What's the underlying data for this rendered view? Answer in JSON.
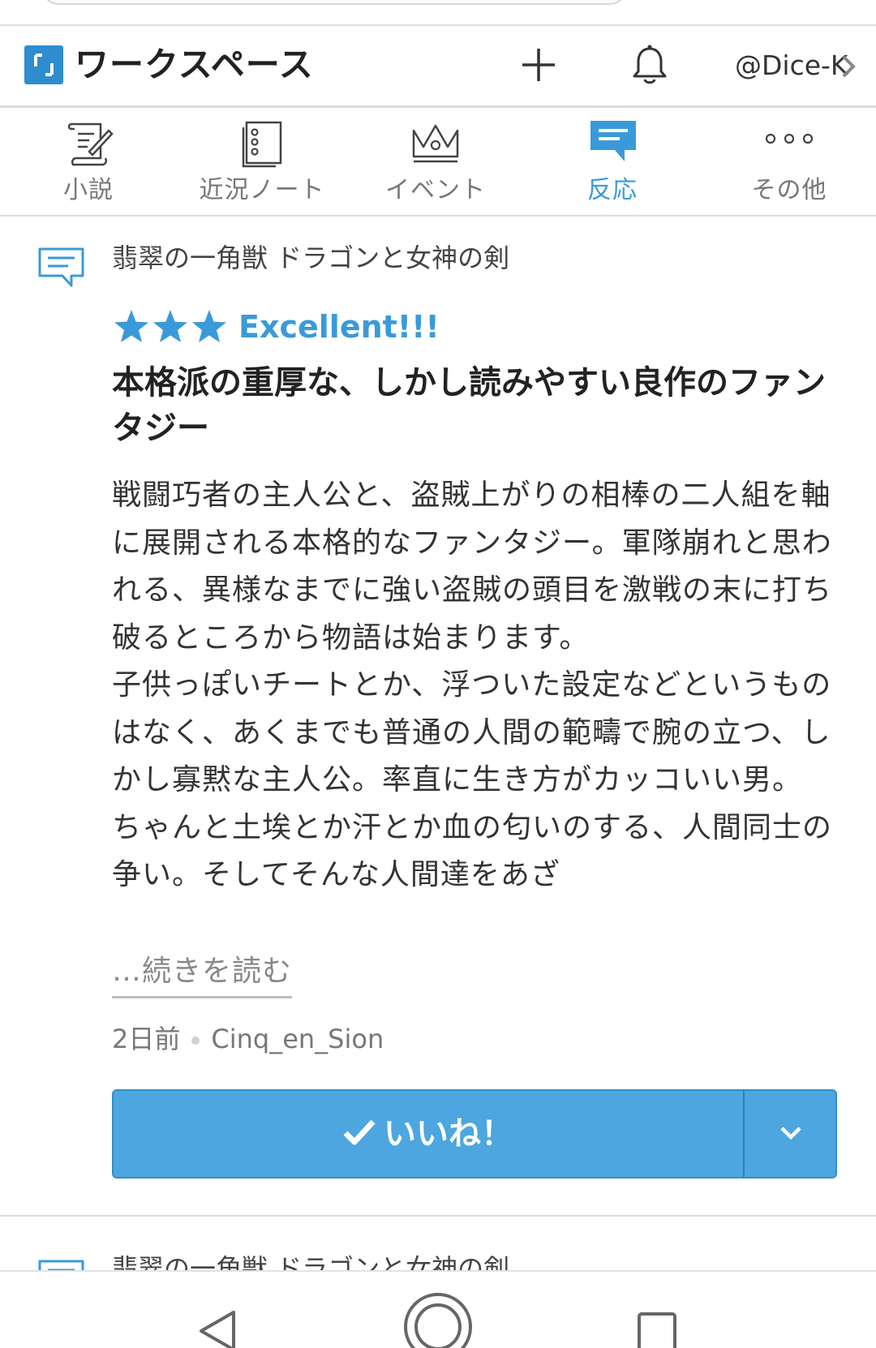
{
  "header": {
    "brand": "ワークスペース",
    "user": "@Dice-K"
  },
  "tabs": [
    {
      "label": "小説",
      "icon": "novel-scroll-icon",
      "active": false
    },
    {
      "label": "近況ノート",
      "icon": "notebook-icon",
      "active": false
    },
    {
      "label": "イベント",
      "icon": "crown-icon",
      "active": false
    },
    {
      "label": "反応",
      "icon": "comment-icon",
      "active": true
    },
    {
      "label": "その他",
      "icon": "more-dots-icon",
      "active": false
    }
  ],
  "review": {
    "work_title": "翡翠の一角獣 ドラゴンと女神の剣",
    "stars": 3,
    "rating_label": "Excellent!!!",
    "title": "本格派の重厚な、しかし読みやすい良作のファンタジー",
    "body": "戦闘巧者の主人公と、盗賊上がりの相棒の二人組を軸に展開される本格的なファンタジー。軍隊崩れと思われる、異様なまでに強い盗賊の頭目を激戦の末に打ち破るところから物語は始まります。\n子供っぽいチートとか、浮ついた設定などというものはなく、あくまでも普通の人間の範疇で腕の立つ、しかし寡黙な主人公。率直に生き方がカッコいい男。\nちゃんと土埃とか汗とか血の匂いのする、人間同士の争い。そしてそんな人間達をあざ",
    "read_more": "…続きを読む",
    "time_ago": "2日前",
    "author": "Cinq_en_Sion",
    "like_label": "いいね！"
  },
  "next_review": {
    "work_title": "翡翠の一角獣 ドラゴンと女神の剣"
  },
  "colors": {
    "accent": "#3a9ad9",
    "button": "#4da6df",
    "logo": "#2e8ccf"
  }
}
